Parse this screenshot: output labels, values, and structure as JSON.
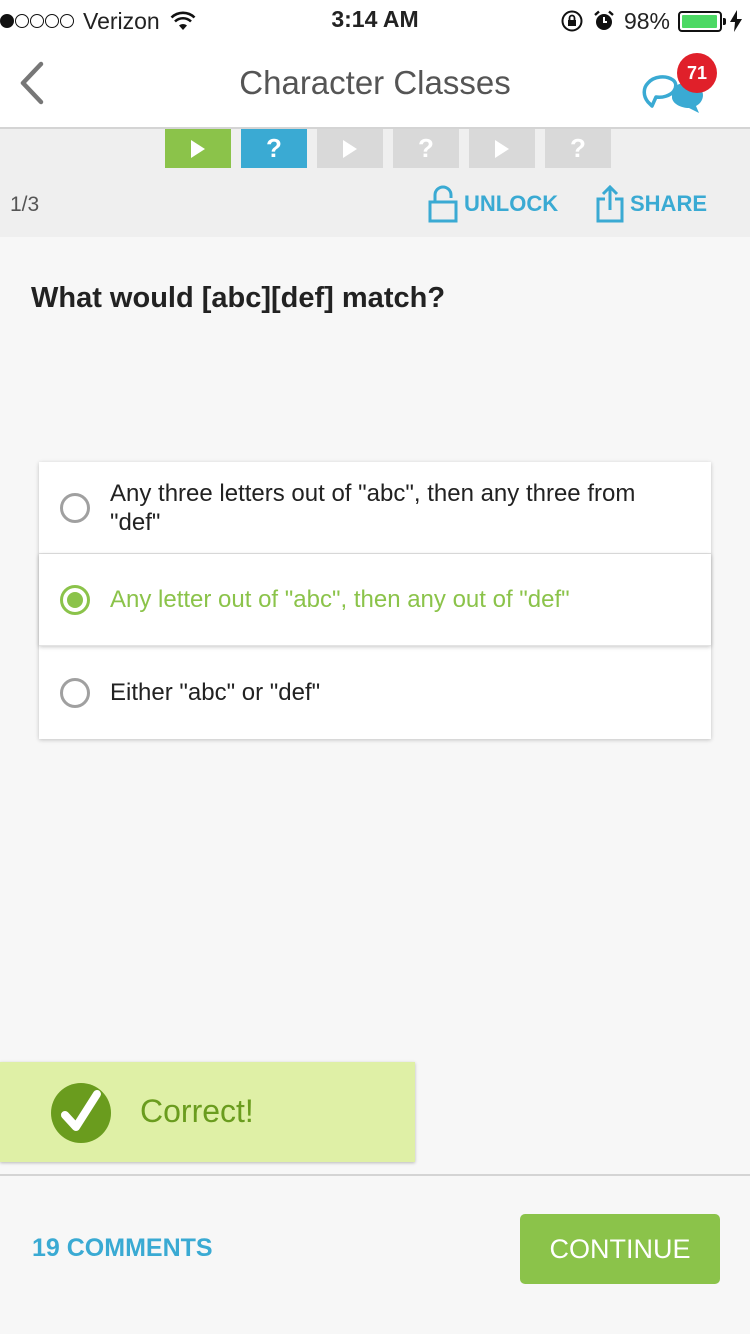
{
  "status_bar": {
    "carrier": "Verizon",
    "time": "3:14 AM",
    "battery_percent": "98%",
    "battery_level": 0.98,
    "signal_bars_filled": 1,
    "signal_bars_total": 5
  },
  "nav": {
    "title": "Character Classes",
    "back_icon": "chevron-left-icon",
    "chat_icon": "chat-bubbles-icon",
    "badge_count": "71"
  },
  "progress": {
    "steps": [
      {
        "type": "lesson",
        "state": "done",
        "glyph": ""
      },
      {
        "type": "quiz",
        "state": "current",
        "glyph": "?"
      },
      {
        "type": "lesson",
        "state": "locked",
        "glyph": ""
      },
      {
        "type": "quiz",
        "state": "locked",
        "glyph": "?"
      },
      {
        "type": "lesson",
        "state": "locked",
        "glyph": ""
      },
      {
        "type": "quiz",
        "state": "locked",
        "glyph": "?"
      }
    ],
    "page_counter": "1/3",
    "unlock_label": "UNLOCK",
    "share_label": "SHARE"
  },
  "question": {
    "text": "What would [abc][def] match?",
    "options": [
      {
        "label": "Any three letters out of \"abc\", then any three from \"def\"",
        "selected": false
      },
      {
        "label": "Any letter out of \"abc\", then any out of \"def\"",
        "selected": true
      },
      {
        "label": "Either \"abc\" or \"def\"",
        "selected": false
      }
    ]
  },
  "feedback": {
    "text": "Correct!",
    "icon": "checkmark-icon"
  },
  "bottom": {
    "comments_label": "19 COMMENTS",
    "continue_label": "CONTINUE"
  },
  "colors": {
    "accent_blue": "#3aaad3",
    "accent_green": "#8bc34a",
    "badge_red": "#e0202a",
    "feedback_bg": "#dff0a6"
  }
}
